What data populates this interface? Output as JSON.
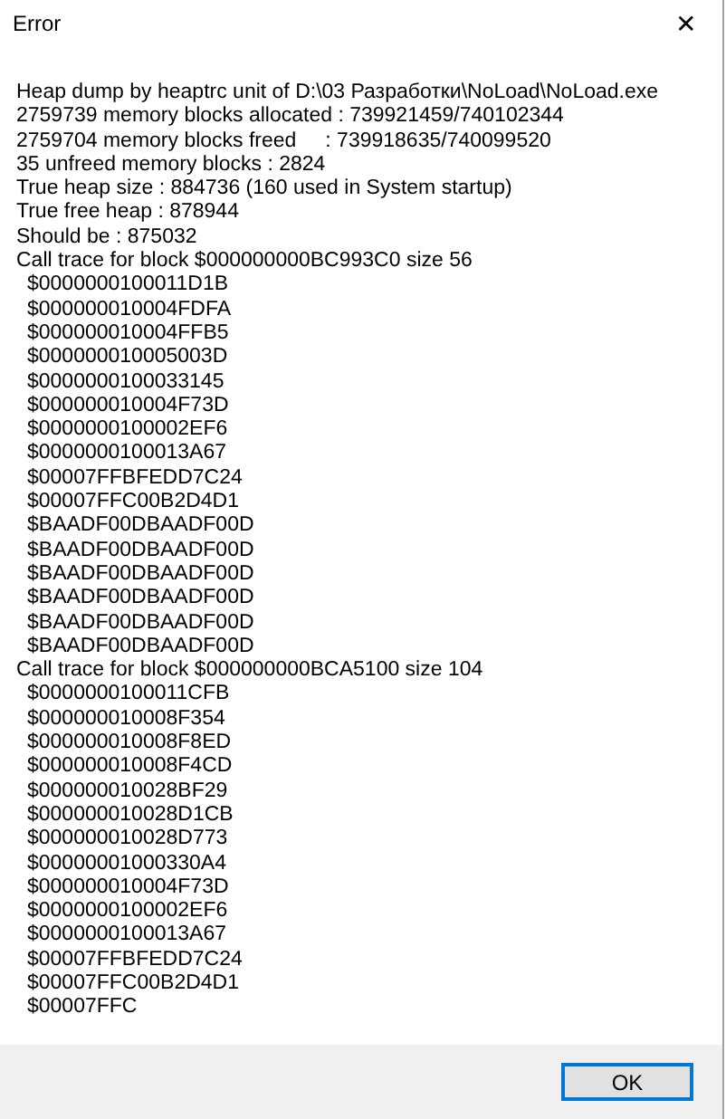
{
  "window": {
    "title": "Error",
    "close": "✕"
  },
  "message": [
    {
      "kind": "line",
      "text": "Heap dump by heaptrc unit of D:\\03 Разработки\\NoLoad\\NoLoad.exe"
    },
    {
      "kind": "line",
      "text": "2759739 memory blocks allocated : 739921459/740102344"
    },
    {
      "kind": "line",
      "text": "2759704 memory blocks freed     : 739918635/740099520"
    },
    {
      "kind": "line",
      "text": "35 unfreed memory blocks : 2824"
    },
    {
      "kind": "line",
      "text": "True heap size : 884736 (160 used in System startup)"
    },
    {
      "kind": "line",
      "text": "True free heap : 878944"
    },
    {
      "kind": "line",
      "text": "Should be : 875032"
    },
    {
      "kind": "line",
      "text": "Call trace for block $000000000BC993C0 size 56"
    },
    {
      "kind": "address",
      "text": "$0000000100011D1B"
    },
    {
      "kind": "address",
      "text": "$000000010004FDFA"
    },
    {
      "kind": "address",
      "text": "$000000010004FFB5"
    },
    {
      "kind": "address",
      "text": "$000000010005003D"
    },
    {
      "kind": "address",
      "text": "$0000000100033145"
    },
    {
      "kind": "address",
      "text": "$000000010004F73D"
    },
    {
      "kind": "address",
      "text": "$0000000100002EF6"
    },
    {
      "kind": "address",
      "text": "$0000000100013A67"
    },
    {
      "kind": "address",
      "text": "$00007FFBFEDD7C24"
    },
    {
      "kind": "address",
      "text": "$00007FFC00B2D4D1"
    },
    {
      "kind": "address",
      "text": "$BAADF00DBAADF00D"
    },
    {
      "kind": "address",
      "text": "$BAADF00DBAADF00D"
    },
    {
      "kind": "address",
      "text": "$BAADF00DBAADF00D"
    },
    {
      "kind": "address",
      "text": "$BAADF00DBAADF00D"
    },
    {
      "kind": "address",
      "text": "$BAADF00DBAADF00D"
    },
    {
      "kind": "address",
      "text": "$BAADF00DBAADF00D"
    },
    {
      "kind": "line",
      "text": "Call trace for block $000000000BCA5100 size 104"
    },
    {
      "kind": "address",
      "text": "$0000000100011CFB"
    },
    {
      "kind": "address",
      "text": "$000000010008F354"
    },
    {
      "kind": "address",
      "text": "$000000010008F8ED"
    },
    {
      "kind": "address",
      "text": "$000000010008F4CD"
    },
    {
      "kind": "address",
      "text": "$000000010028BF29"
    },
    {
      "kind": "address",
      "text": "$000000010028D1CB"
    },
    {
      "kind": "address",
      "text": "$000000010028D773"
    },
    {
      "kind": "address",
      "text": "$00000001000330A4"
    },
    {
      "kind": "address",
      "text": "$000000010004F73D"
    },
    {
      "kind": "address",
      "text": "$0000000100002EF6"
    },
    {
      "kind": "address",
      "text": "$0000000100013A67"
    },
    {
      "kind": "address",
      "text": "$00007FFBFEDD7C24"
    },
    {
      "kind": "address",
      "text": "$00007FFC00B2D4D1"
    },
    {
      "kind": "address",
      "text": "$00007FFC"
    }
  ],
  "buttons": [
    {
      "label": "OK",
      "selected": true
    }
  ]
}
